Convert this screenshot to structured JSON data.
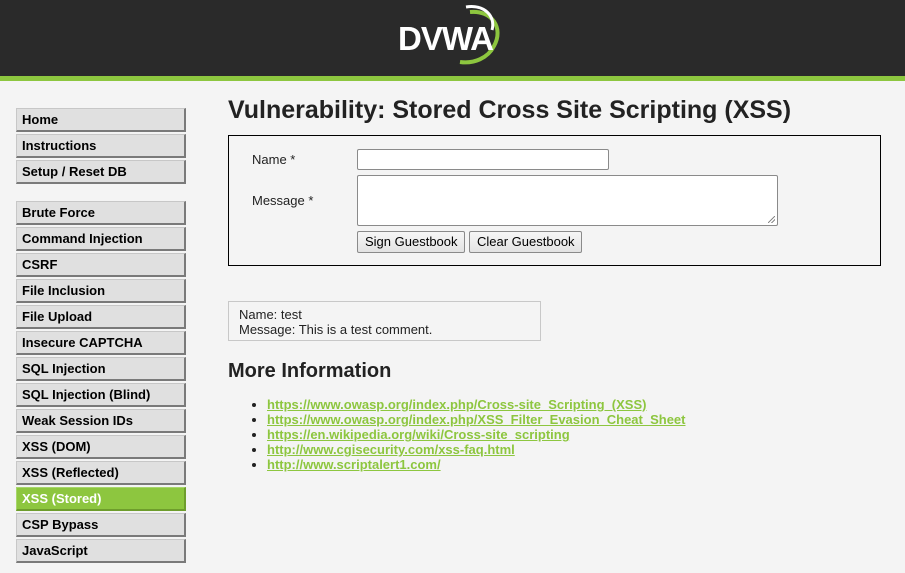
{
  "header": {
    "logo_text": "DVWA"
  },
  "sidebar": {
    "block1": [
      {
        "label": "Home"
      },
      {
        "label": "Instructions"
      },
      {
        "label": "Setup / Reset DB"
      }
    ],
    "block2": [
      {
        "label": "Brute Force"
      },
      {
        "label": "Command Injection"
      },
      {
        "label": "CSRF"
      },
      {
        "label": "File Inclusion"
      },
      {
        "label": "File Upload"
      },
      {
        "label": "Insecure CAPTCHA"
      },
      {
        "label": "SQL Injection"
      },
      {
        "label": "SQL Injection (Blind)"
      },
      {
        "label": "Weak Session IDs"
      },
      {
        "label": "XSS (DOM)"
      },
      {
        "label": "XSS (Reflected)"
      },
      {
        "label": "XSS (Stored)",
        "selected": true
      },
      {
        "label": "CSP Bypass"
      },
      {
        "label": "JavaScript"
      }
    ]
  },
  "main": {
    "title": "Vulnerability: Stored Cross Site Scripting (XSS)",
    "form": {
      "name_label": "Name *",
      "name_value": "",
      "message_label": "Message *",
      "message_value": "",
      "sign_button": "Sign Guestbook",
      "clear_button": "Clear Guestbook"
    },
    "entry": {
      "name_line": "Name: test",
      "message_line": "Message: This is a test comment."
    },
    "more_info_title": "More Information",
    "links": [
      "https://www.owasp.org/index.php/Cross-site_Scripting_(XSS)",
      "https://www.owasp.org/index.php/XSS_Filter_Evasion_Cheat_Sheet",
      "https://en.wikipedia.org/wiki/Cross-site_scripting",
      "http://www.cgisecurity.com/xss-faq.html",
      "http://www.scriptalert1.com/"
    ]
  },
  "colors": {
    "accent": "#8dc63f",
    "header_bg": "#2a2a2a",
    "page_bg": "#f4f4f4"
  }
}
